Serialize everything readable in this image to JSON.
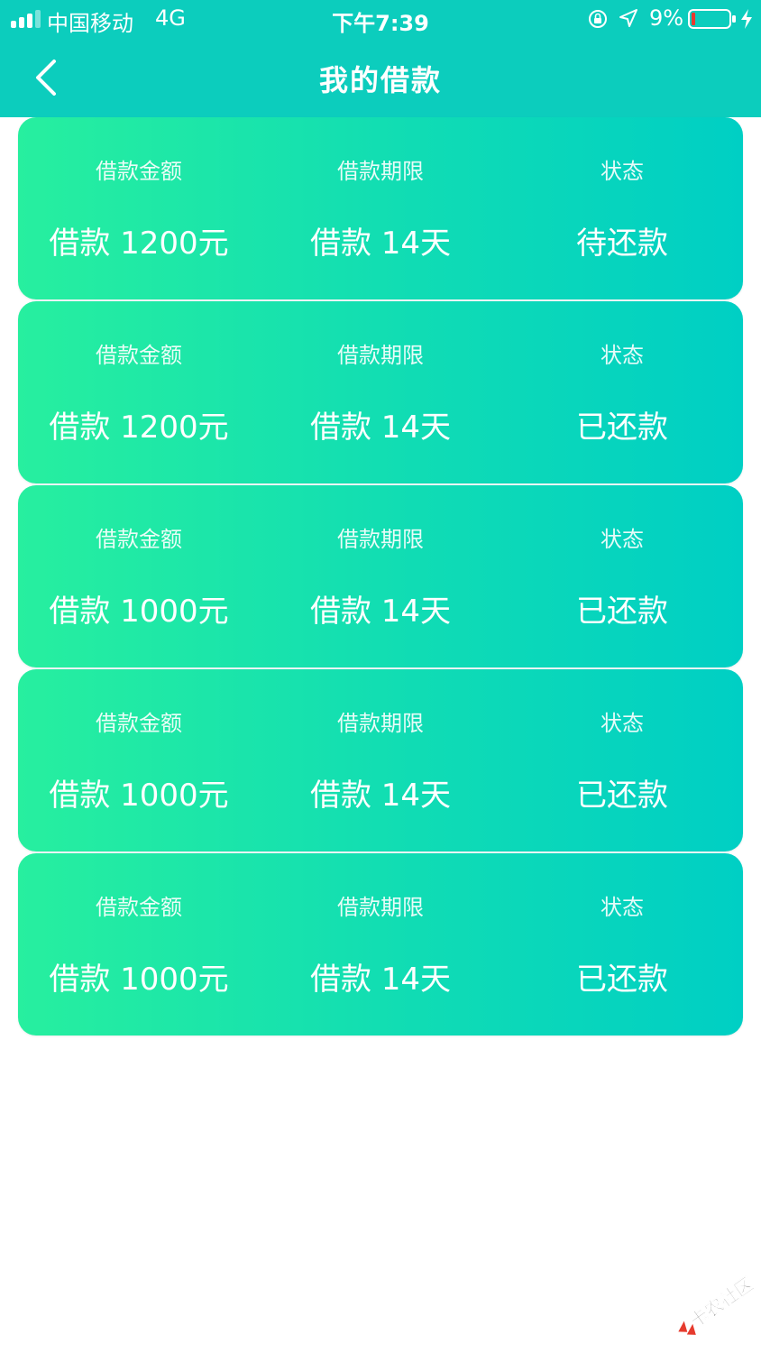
{
  "status_bar": {
    "carrier": "中国移动",
    "network": "4G",
    "time": "下午7:39",
    "battery_percent": "9%",
    "icons": [
      "signal-icon",
      "orientation-lock-icon",
      "location-icon",
      "battery-icon",
      "charging-icon"
    ]
  },
  "header": {
    "title": "我的借款",
    "back_icon": "chevron-left-icon"
  },
  "loans": [
    {
      "amount_label": "借款金额",
      "amount": "借款 1200元",
      "term_label": "借款期限",
      "term": "借款 14天",
      "status_label": "状态",
      "status": "待还款"
    },
    {
      "amount_label": "借款金额",
      "amount": "借款 1200元",
      "term_label": "借款期限",
      "term": "借款 14天",
      "status_label": "状态",
      "status": "已还款"
    },
    {
      "amount_label": "借款金额",
      "amount": "借款 1000元",
      "term_label": "借款期限",
      "term": "借款 14天",
      "status_label": "状态",
      "status": "已还款"
    },
    {
      "amount_label": "借款金额",
      "amount": "借款 1000元",
      "term_label": "借款期限",
      "term": "借款 14天",
      "status_label": "状态",
      "status": "已还款"
    },
    {
      "amount_label": "借款金额",
      "amount": "借款 1000元",
      "term_label": "借款期限",
      "term": "借款 14天",
      "status_label": "状态",
      "status": "已还款"
    }
  ],
  "watermark": {
    "text": "卡农社区"
  },
  "colors": {
    "header": "#0ccdbd",
    "card_gradient_start": "#27ef9f",
    "card_gradient_end": "#00cfc4",
    "text": "#ffffff"
  }
}
